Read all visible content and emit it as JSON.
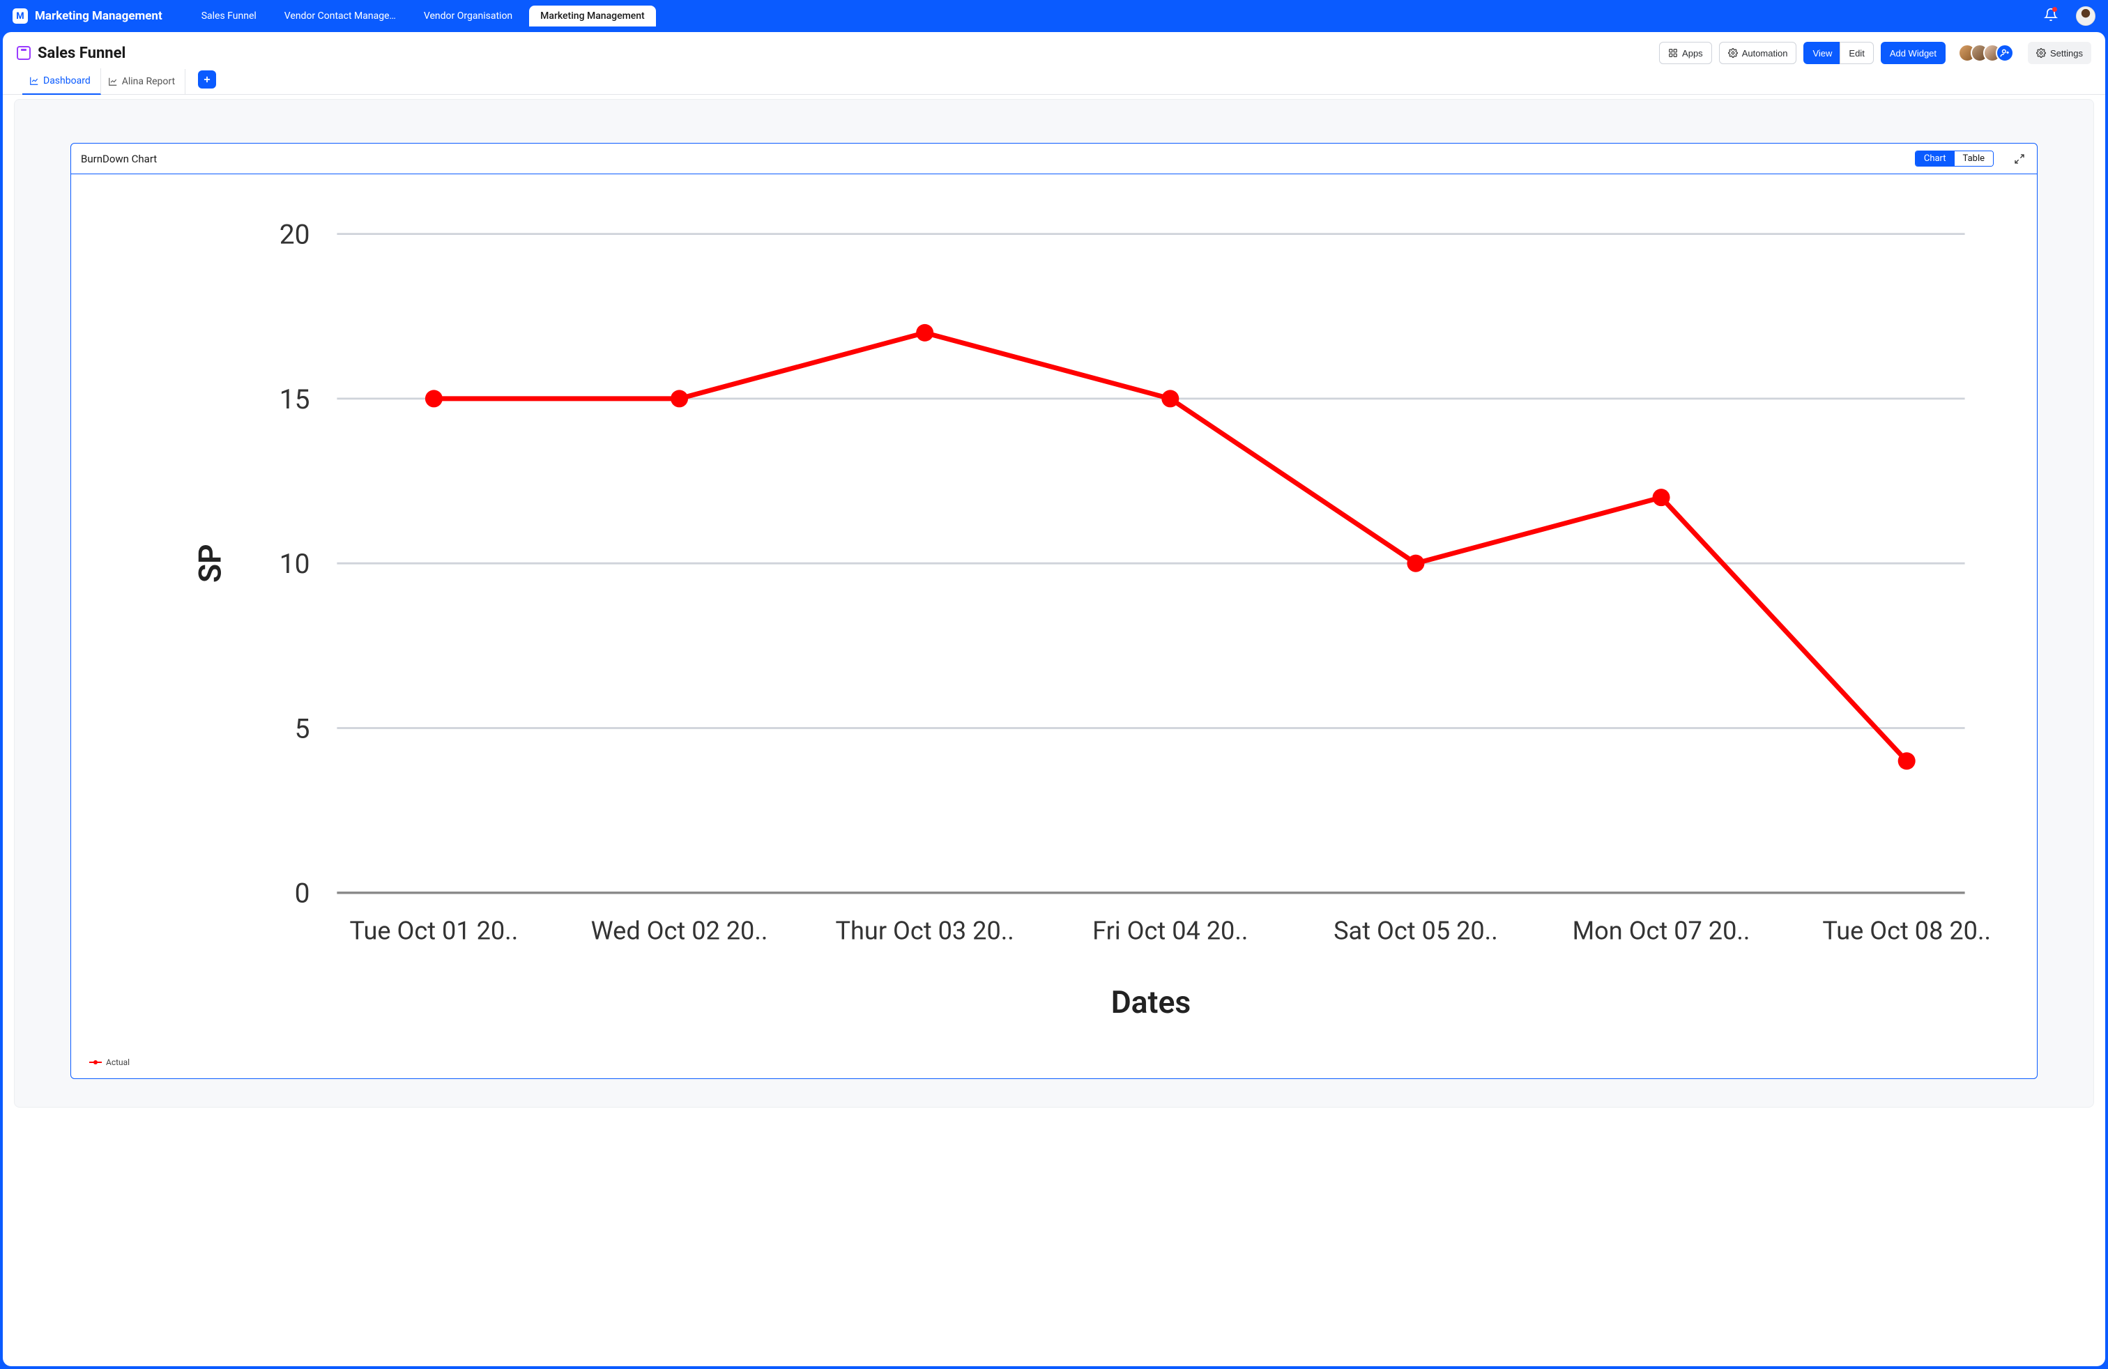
{
  "app": {
    "icon_letter": "M",
    "title": "Marketing Management"
  },
  "top_tabs": [
    {
      "label": "Sales Funnel",
      "active": false
    },
    {
      "label": "Vendor Contact Manage…",
      "active": false
    },
    {
      "label": "Vendor Organisation",
      "active": false
    },
    {
      "label": "Marketing Management",
      "active": true
    }
  ],
  "page": {
    "title": "Sales Funnel"
  },
  "toolbar": {
    "apps": "Apps",
    "automation": "Automation",
    "view": "View",
    "edit": "Edit",
    "add_widget": "Add Widget",
    "settings": "Settings"
  },
  "subtabs": {
    "dashboard": "Dashboard",
    "alina_report": "Alina Report"
  },
  "card": {
    "title": "BurnDown Chart",
    "chart_seg": "Chart",
    "table_seg": "Table"
  },
  "legend": {
    "actual": "Actual"
  },
  "avatar_colors": {
    "a1": "linear-gradient(135deg,#d9a066,#8b5a2b)",
    "a2": "linear-gradient(135deg,#c0a080,#6b4423)",
    "a3": "linear-gradient(135deg,#e8c8b0,#7a5230)"
  },
  "chart_data": {
    "type": "line",
    "title": "BurnDown Chart",
    "xlabel": "Dates",
    "ylabel": "SP",
    "ylim": [
      0,
      20
    ],
    "yticks": [
      0,
      5,
      10,
      15,
      20
    ],
    "categories": [
      "Tue Oct 01 20..",
      "Wed Oct 02 20..",
      "Thur Oct 03 20..",
      "Fri Oct 04 20..",
      "Sat Oct 05 20..",
      "Mon Oct 07 20..",
      "Tue Oct 08 20.."
    ],
    "series": [
      {
        "name": "Actual",
        "color": "#ff0000",
        "values": [
          15,
          15,
          17,
          15,
          10,
          12,
          4
        ]
      }
    ]
  }
}
